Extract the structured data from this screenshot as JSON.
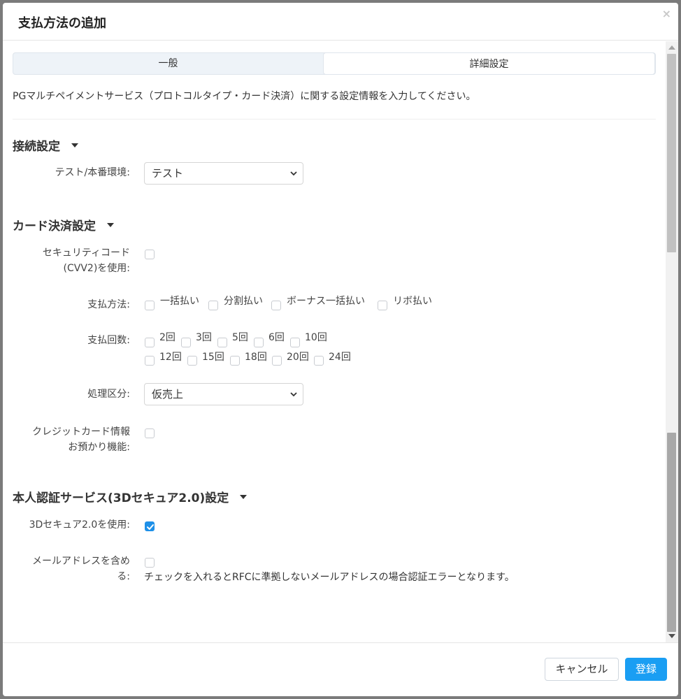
{
  "modal": {
    "title": "支払方法の追加",
    "close_glyph": "×"
  },
  "tabs": [
    {
      "label": "一般",
      "active": false
    },
    {
      "label": "詳細設定",
      "active": true
    }
  ],
  "intro": "PGマルチペイメントサービス（プロトコルタイプ・カード決済）に関する設定情報を入力してください。",
  "sections": {
    "connection": {
      "title": "接続設定",
      "env_label": "テスト/本番環境:",
      "env_value": "テスト"
    },
    "card": {
      "title": "カード決済設定",
      "cvv_label_1": "セキュリティコード",
      "cvv_label_2": "(CVV2)を使用:",
      "cvv_checked": false,
      "method_label": "支払方法:",
      "methods": [
        "一括払い",
        "分割払い",
        "ボーナス一括払い",
        "リボ払い"
      ],
      "count_label": "支払回数:",
      "counts_row1": [
        "2回",
        "3回",
        "5回",
        "6回",
        "10回"
      ],
      "counts_row2": [
        "12回",
        "15回",
        "18回",
        "20回",
        "24回"
      ],
      "process_label": "処理区分:",
      "process_value": "仮売上",
      "store_label_1": "クレジットカード情報",
      "store_label_2": "お預かり機能:",
      "store_checked": false
    },
    "auth": {
      "title": "本人認証サービス(3Dセキュア2.0)設定",
      "use_label": "3Dセキュア2.0を使用:",
      "use_checked": true,
      "email_label_1": "メールアドレスを含め",
      "email_label_2": "る:",
      "email_checked": false,
      "email_note": "チェックを入れるとRFCに準拠しないメールアドレスの場合認証エラーとなります。"
    }
  },
  "footer": {
    "cancel": "キャンセル",
    "submit": "登録"
  },
  "colors": {
    "primary": "#1a9ef3",
    "checked": "#1e90e8",
    "overlay": "#7b7b7b"
  }
}
